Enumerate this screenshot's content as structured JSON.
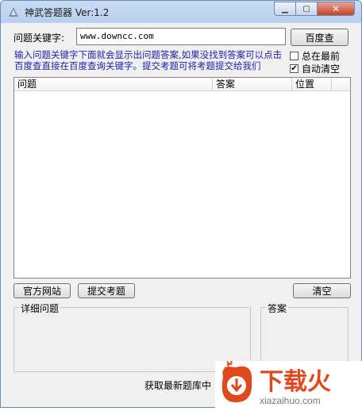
{
  "window": {
    "title": "神武答题器 Ver:1.2",
    "min_icon": "minimize-icon",
    "max_icon": "maximize-icon",
    "close_icon": "close-icon"
  },
  "search": {
    "label": "问题关键字:",
    "value": "www.downcc.com",
    "button": "百度查"
  },
  "hint": "输入问题关键字下面就会显示出问题答案,如果没找到答案可以点击百度查直接在百度查询关键字。提交考题可将考题提交给我们",
  "options": {
    "always_on_top": {
      "label": "总在最前",
      "checked": false
    },
    "auto_clear": {
      "label": "自动清空",
      "checked": true
    }
  },
  "table": {
    "columns": [
      "问题",
      "答案",
      "位置"
    ],
    "rows": []
  },
  "buttons": {
    "official_site": "官方网站",
    "submit_question": "提交考题",
    "clear": "清空"
  },
  "details": {
    "question_title": "详细问题",
    "answer_title": "答案"
  },
  "status": "获取最新题库中",
  "watermark": {
    "brand": "下载火",
    "url": "xiazaihuo.com",
    "color": "#e2481e"
  }
}
